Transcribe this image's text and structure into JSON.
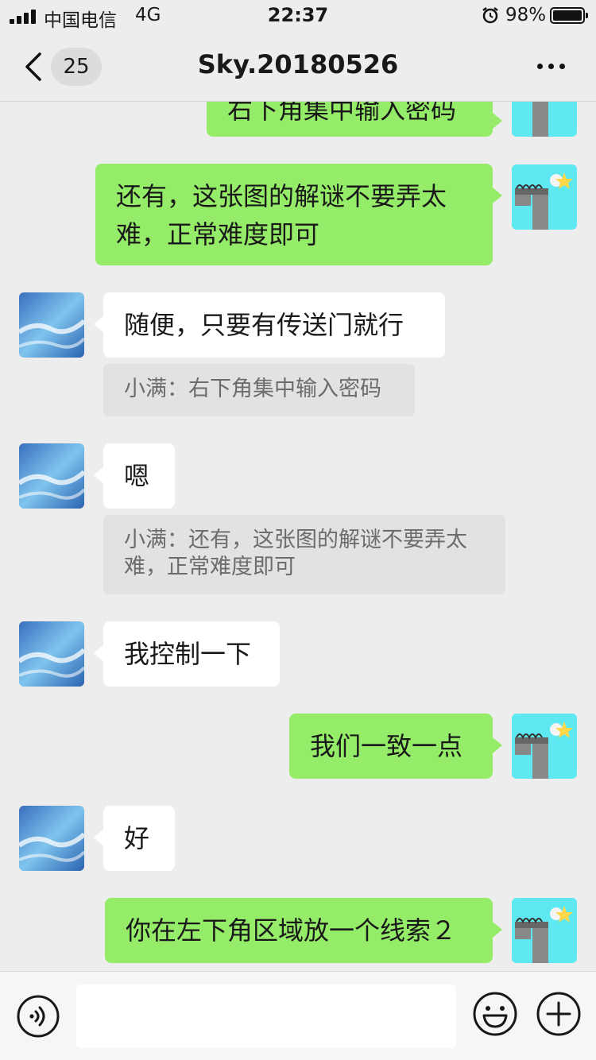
{
  "status_bar": {
    "carrier": "中国电信",
    "network": "4G",
    "time": "22:37",
    "battery_percent": "98%",
    "battery_level": 0.98
  },
  "nav": {
    "unread_count": "25",
    "title": "Sky.20180526",
    "back_icon": "chevron-left-icon",
    "more_icon": "more-dots-icon"
  },
  "messages": [
    {
      "side": "right",
      "text": "右下角集中输入密码"
    },
    {
      "side": "right",
      "text": "还有，这张图的解谜不要弄太难，正常难度即可"
    },
    {
      "side": "left",
      "text": "随便，只要有传送门就行",
      "quote": "小满：右下角集中输入密码"
    },
    {
      "side": "left",
      "text": "嗯",
      "quote": "小满：还有，这张图的解谜不要弄太难，正常难度即可"
    },
    {
      "side": "left",
      "text": "我控制一下"
    },
    {
      "side": "right",
      "text": "我们一致一点"
    },
    {
      "side": "left",
      "text": "好"
    },
    {
      "side": "right",
      "text": "你在左下角区域放一个线索２"
    }
  ],
  "input_bar": {
    "voice_icon": "voice-icon",
    "emoji_icon": "emoji-icon",
    "add_icon": "plus-circle-icon",
    "input_value": ""
  },
  "colors": {
    "background": "#ededed",
    "outgoing_bubble": "#95ec69",
    "incoming_bubble": "#ffffff",
    "quote_bubble": "#e2e2e2"
  }
}
